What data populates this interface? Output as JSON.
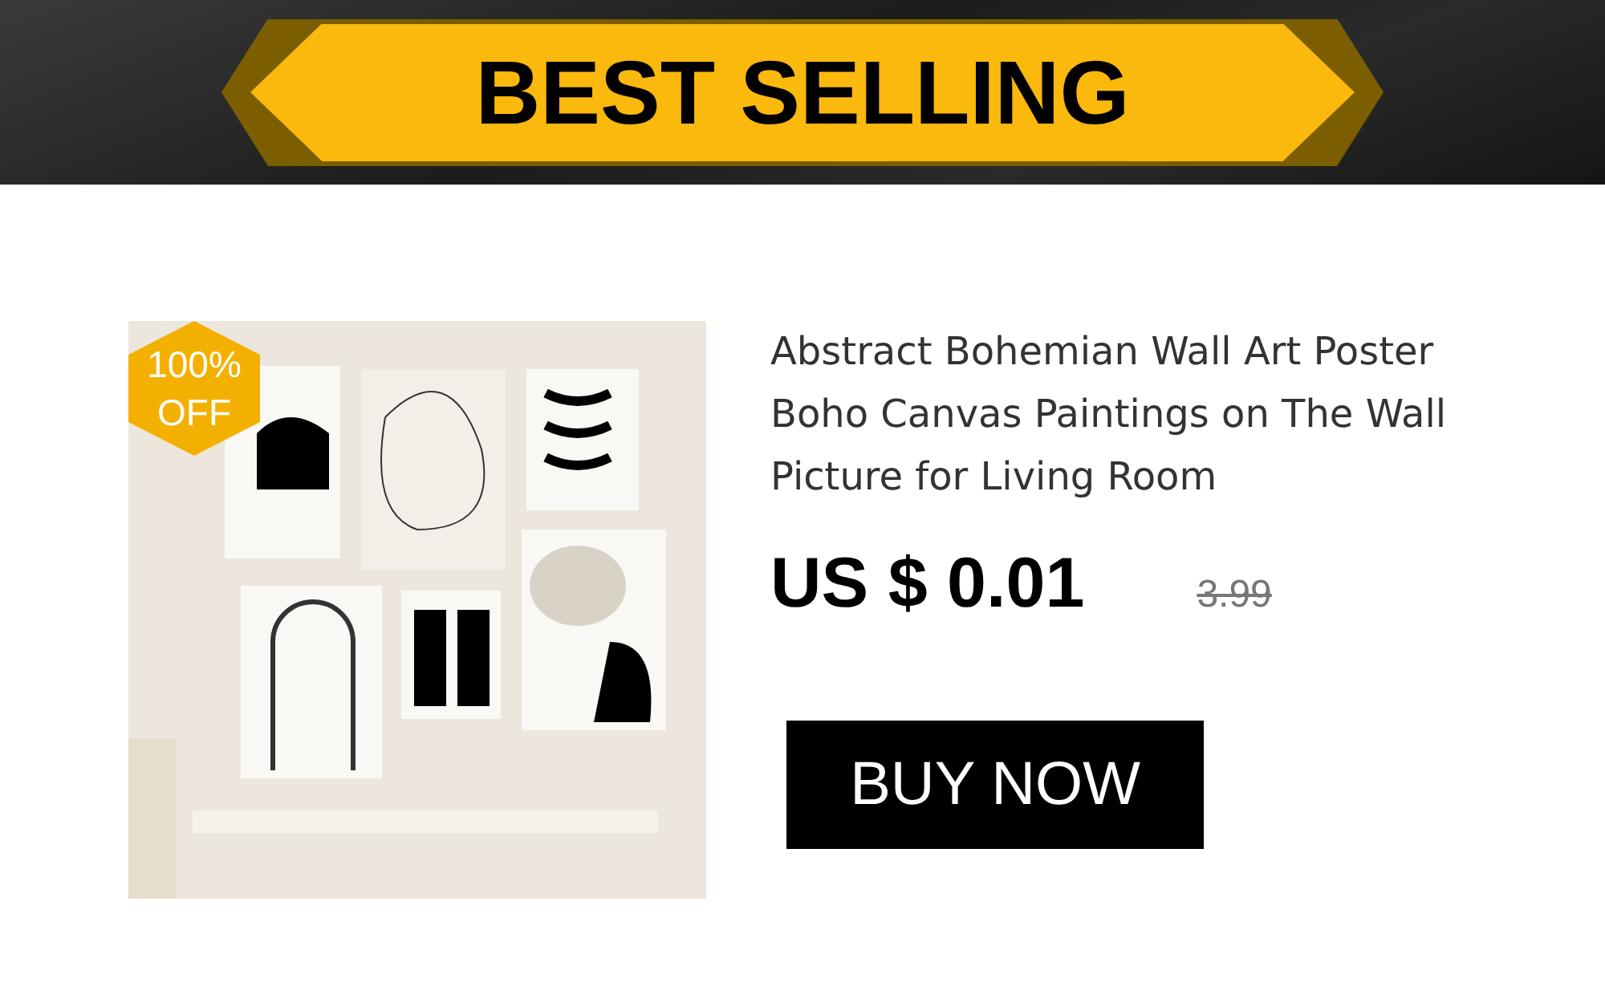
{
  "banner": {
    "title": "BEST SELLING"
  },
  "product": {
    "badge": "100% OFF",
    "title": "Abstract Bohemian Wall Art Poster Boho Canvas Paintings on The Wall Picture for Living Room",
    "price": "US $ 0.01",
    "old_price": "3.99",
    "button": "BUY NOW"
  }
}
